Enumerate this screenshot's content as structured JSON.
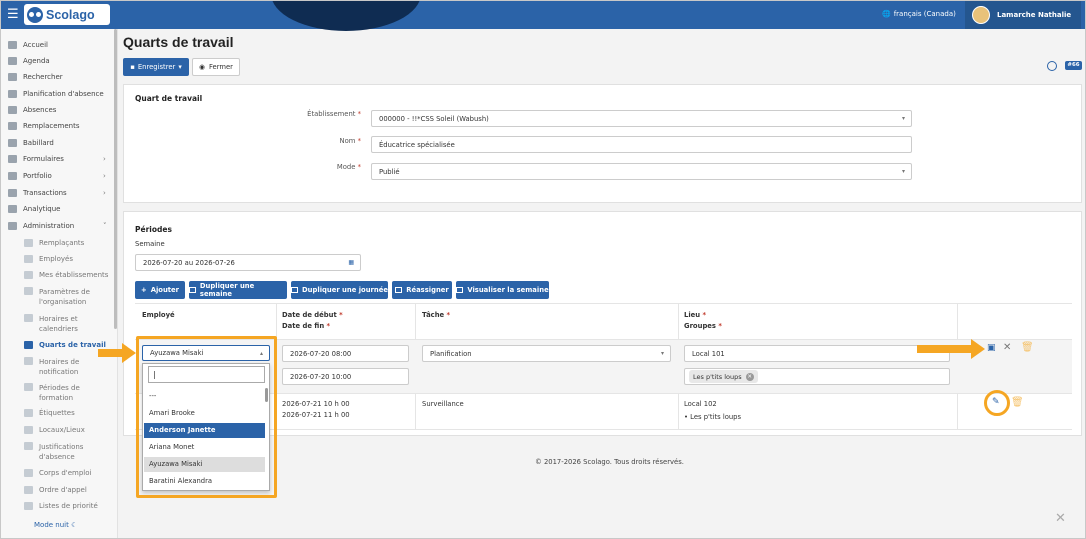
{
  "topbar": {
    "menu_icon": "hamburger-icon",
    "app_name": "Scolago",
    "language": "français (Canada)",
    "user_name": "Lamarche Nathalie"
  },
  "sidebar": {
    "items": [
      {
        "label": "Accueil",
        "icon": "home-icon"
      },
      {
        "label": "Agenda",
        "icon": "calendar-icon"
      },
      {
        "label": "Rechercher",
        "icon": "search-icon"
      },
      {
        "label": "Planification d'absence",
        "icon": "calendar-icon"
      },
      {
        "label": "Absences",
        "icon": "user-minus-icon"
      },
      {
        "label": "Remplacements",
        "icon": "swap-icon"
      },
      {
        "label": "Babillard",
        "icon": "board-icon"
      },
      {
        "label": "Formulaires",
        "icon": "form-icon"
      },
      {
        "label": "Portfolio",
        "icon": "trophy-icon"
      },
      {
        "label": "Transactions",
        "icon": "transactions-icon"
      },
      {
        "label": "Analytique",
        "icon": "chart-icon"
      },
      {
        "label": "Administration",
        "icon": "gear-icon"
      }
    ],
    "subitems": [
      {
        "label": "Remplaçants"
      },
      {
        "label": "Employés"
      },
      {
        "label": "Mes établissements"
      },
      {
        "label": "Paramètres de",
        "label2": "l'organisation"
      },
      {
        "label": "Horaires et",
        "label2": "calendriers"
      },
      {
        "label": "Quarts de travail"
      },
      {
        "label": "Horaires de",
        "label2": "notification"
      },
      {
        "label": "Périodes de",
        "label2": "formation"
      },
      {
        "label": "Étiquettes"
      },
      {
        "label": "Locaux/Lieux"
      },
      {
        "label": "Justifications",
        "label2": "d'absence"
      },
      {
        "label": "Corps d'emploi"
      },
      {
        "label": "Ordre d'appel"
      },
      {
        "label": "Listes de priorité"
      }
    ],
    "night_mode": "Mode nuit"
  },
  "page": {
    "title": "Quarts de travail",
    "save_label": "Enregistrer",
    "close_label": "Fermer",
    "badge": "#66"
  },
  "shift": {
    "section_title": "Quart de travail",
    "etablissement_label": "Établissement",
    "etablissement_value": "000000 - !!*CSS Soleil (Wabush)",
    "nom_label": "Nom",
    "nom_value": "Éducatrice spécialisée",
    "mode_label": "Mode",
    "mode_value": "Publié",
    "required_mark": "*"
  },
  "periods": {
    "section_title": "Périodes",
    "semaine_label": "Semaine",
    "semaine_value": "2026-07-20 au 2026-07-26",
    "buttons": [
      "Ajouter",
      "Dupliquer une semaine",
      "Dupliquer une journée",
      "Réassigner",
      "Visualiser la semaine"
    ],
    "columns": {
      "employe": "Employé",
      "debut": "Date de début",
      "fin": "Date de fin",
      "tache": "Tâche",
      "lieu": "Lieu",
      "groupes": "Groupes"
    },
    "rows": [
      {
        "employe": "Ayuzawa Misaki",
        "debut": "2026-07-20 08:00",
        "fin": "2026-07-20 10:00",
        "tache": "Planification",
        "lieu": "Local 101",
        "groupe": "Les p'tits loups"
      },
      {
        "debut": "2026-07-21 10 h 00",
        "fin": "2026-07-21 11 h 00",
        "tache": "Surveillance",
        "lieu": "Local 102",
        "groupe": "Les p'tits loups"
      }
    ],
    "dropdown_options": [
      "---",
      "Amari Brooke",
      "Anderson Janette",
      "Ariana Monet",
      "Ayuzawa Misaki",
      "Baratini Alexandra"
    ],
    "dropdown_search": "|"
  },
  "footer": "© 2017-2026 Scolago. Tous droits réservés.",
  "colors": {
    "primary": "#2b63a8",
    "annotation": "#f5a623"
  }
}
